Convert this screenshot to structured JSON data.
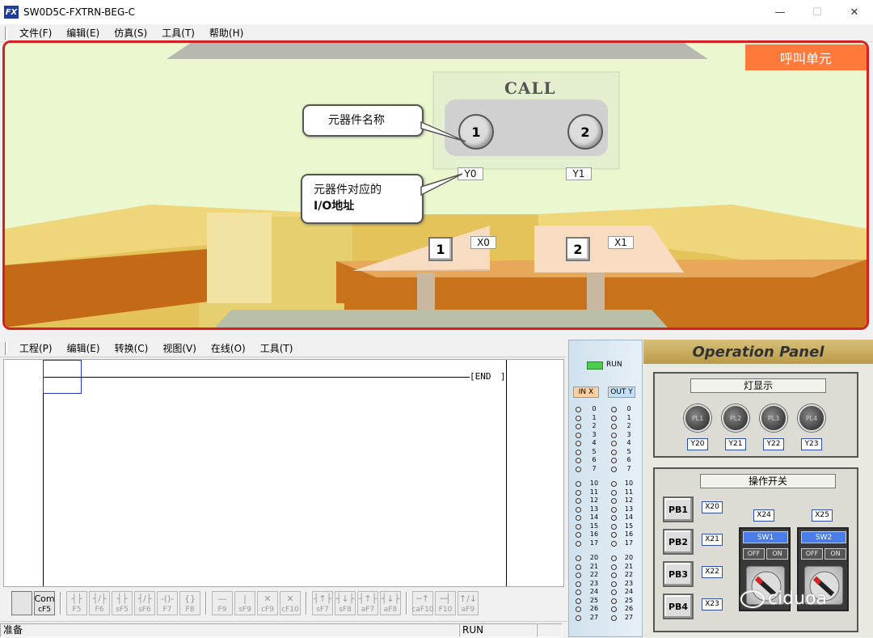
{
  "window": {
    "title": "SW0D5C-FXTRN-BEG-C",
    "app_icon": "FX",
    "minimize": "—",
    "maximize": "☐",
    "close": "✕"
  },
  "menu": [
    "文件(F)",
    "编辑(E)",
    "仿真(S)",
    "工具(T)",
    "帮助(H)"
  ],
  "sim": {
    "unit_label": "呼叫单元",
    "call_title": "CALL",
    "call_buttons": [
      "1",
      "2"
    ],
    "output_addresses": [
      "Y0",
      "Y1"
    ],
    "seat_buttons": [
      "1",
      "2"
    ],
    "input_addresses": [
      "X0",
      "X1"
    ],
    "callout_name": "元器件名称",
    "callout_io_line1": "元器件对应的",
    "callout_io_line2": "I/O地址"
  },
  "ladder": {
    "menu": [
      "工程(P)",
      "编辑(E)",
      "转换(C)",
      "视图(V)",
      "在线(O)",
      "工具(T)"
    ],
    "end_instruction": "[END",
    "end_bracket": "]"
  },
  "toolbar": [
    {
      "sym": "",
      "label": "",
      "enabled": true
    },
    {
      "sym": "Com",
      "label": "cF5",
      "enabled": true
    },
    {
      "sym": "┤├",
      "label": "F5"
    },
    {
      "sym": "┤/├",
      "label": "F6"
    },
    {
      "sym": "┤├",
      "label": "sF5"
    },
    {
      "sym": "┤/├",
      "label": "sF6"
    },
    {
      "sym": "-()-",
      "label": "F7"
    },
    {
      "sym": "{}",
      "label": "F8"
    },
    {
      "sym": "—",
      "label": "F9"
    },
    {
      "sym": "|",
      "label": "sF9"
    },
    {
      "sym": "✕",
      "label": "cF9"
    },
    {
      "sym": "✕",
      "label": "cF10"
    },
    {
      "sym": "┤↑├",
      "label": "sF7"
    },
    {
      "sym": "┤↓├",
      "label": "sF8"
    },
    {
      "sym": "┤↑├",
      "label": "aF7"
    },
    {
      "sym": "┤↓├",
      "label": "aF8"
    },
    {
      "sym": "─↑",
      "label": "caF10"
    },
    {
      "sym": "─┤",
      "label": "F10"
    },
    {
      "sym": "↑/↓",
      "label": "aF9"
    }
  ],
  "status": {
    "left": "准备",
    "mode": "RUN"
  },
  "io": {
    "run_label": "RUN",
    "in_header": "IN X",
    "out_header": "OUT Y",
    "groups": [
      [
        "0",
        "1",
        "2",
        "3",
        "4",
        "5",
        "6",
        "7"
      ],
      [
        "10",
        "11",
        "12",
        "13",
        "14",
        "15",
        "16",
        "17"
      ],
      [
        "20",
        "21",
        "22",
        "23",
        "24",
        "25",
        "26",
        "27"
      ]
    ]
  },
  "panel": {
    "title": "Operation Panel",
    "lamp_section": "灯显示",
    "lamps": [
      {
        "label": "PL1",
        "addr": "Y20"
      },
      {
        "label": "PL2",
        "addr": "Y21"
      },
      {
        "label": "PL3",
        "addr": "Y22"
      },
      {
        "label": "PL4",
        "addr": "Y23"
      }
    ],
    "switch_section": "操作开关",
    "push_buttons": [
      {
        "label": "PB1",
        "addr": "X20"
      },
      {
        "label": "PB2",
        "addr": "X21"
      },
      {
        "label": "PB3",
        "addr": "X22"
      },
      {
        "label": "PB4",
        "addr": "X23"
      }
    ],
    "switches": [
      {
        "label": "SW1",
        "addr": "X24",
        "off": "OFF",
        "on": "ON"
      },
      {
        "label": "SW2",
        "addr": "X25",
        "off": "OFF",
        "on": "ON"
      }
    ]
  },
  "watermark": "ciduoa",
  "colors": {
    "sim_border": "#d42020",
    "unit_label": "#ff7a3a",
    "run_led": "#4ccd4c",
    "switch_name": "#4a7de8"
  }
}
